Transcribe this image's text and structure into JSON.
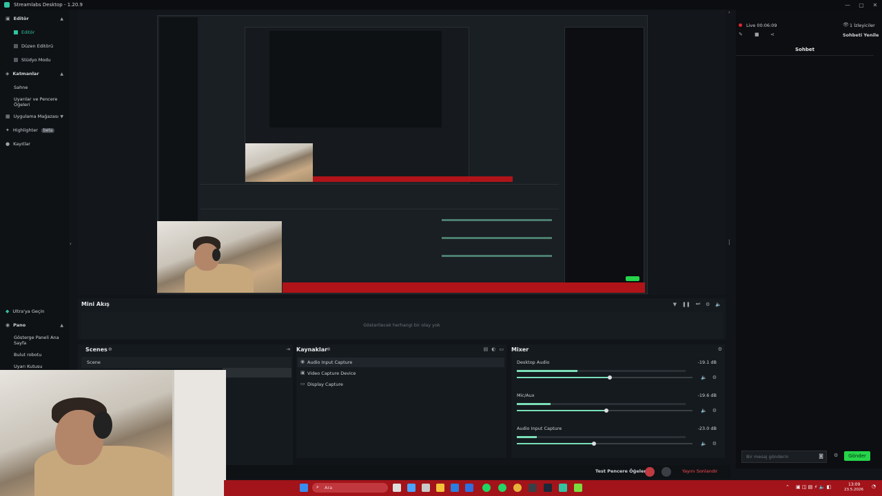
{
  "window": {
    "title": "Streamlabs Desktop - 1.20.9"
  },
  "sidebar": {
    "editor_header": "Editör",
    "items": [
      {
        "label": "Editör"
      },
      {
        "label": "Düzen Editörü"
      },
      {
        "label": "Stüdyo Modu"
      }
    ],
    "layers_header": "Katmanlar",
    "layer_items": [
      {
        "label": "Sahne"
      },
      {
        "label": "Uyarılar ve Pencere Öğeleri"
      }
    ],
    "app_store": "Uygulama Mağazası",
    "highlighter": "Highlighter",
    "highlighter_badge": "beta",
    "recordings": "Kayıtlar",
    "ultra": "Ultra'ya Geçin",
    "panel_header": "Pano",
    "panel_items": [
      {
        "label": "Gösterge Paneli Ana Sayfa"
      },
      {
        "label": "Bulut robotu"
      },
      {
        "label": "Uyarı Kutusu"
      }
    ]
  },
  "mini_feed": {
    "title": "Mini Akış",
    "empty_text": "Gösterilecek herhangi bir olay yok"
  },
  "scenes": {
    "title": "Scenes",
    "items": [
      "Scene"
    ]
  },
  "sources": {
    "title": "Kaynaklar",
    "items": [
      "Audio Input Capture",
      "Video Capture Device",
      "Display Capture"
    ]
  },
  "mixer": {
    "title": "Mixer",
    "channels": [
      {
        "name": "Desktop Audio",
        "db": "-19.1 dB",
        "level": 0.36,
        "volume": 0.53
      },
      {
        "name": "Mic/Aux",
        "db": "-19.6 dB",
        "level": 0.2,
        "volume": 0.51
      },
      {
        "name": "Audio Input Capture",
        "db": "-23.0 dB",
        "level": 0.12,
        "volume": 0.44
      }
    ]
  },
  "bottom": {
    "test_widgets": "Test Pencere Öğeleri",
    "end_stream": "Yayını Sonlandır"
  },
  "chat": {
    "live": "Live 00:06:09",
    "viewers": "1 İzleyiciler",
    "refresh": "Sohbeti Yenile",
    "title": "Sohbet",
    "input_placeholder": "Bir mesaj gönderin",
    "send": "Gönder"
  },
  "taskbar": {
    "search_placeholder": "Ara",
    "time": "13:09",
    "date": "23.5.2026"
  },
  "colors": {
    "accent": "#31c3a2",
    "live": "#e0262e",
    "send": "#26d44a",
    "taskbar": "#a2141a"
  }
}
